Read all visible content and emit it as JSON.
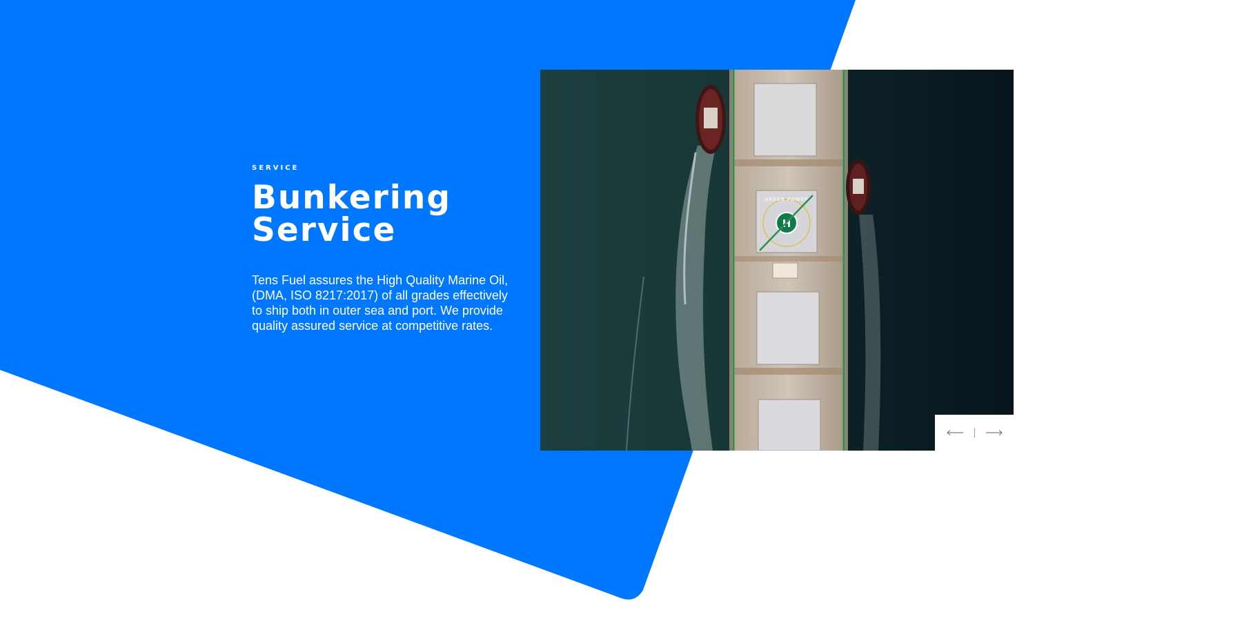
{
  "section": {
    "eyebrow": "SERVICE",
    "title": "Bunkering Service",
    "description": "Tens Fuel assures the High Quality Marine Oil, (DMA, ISO 8217:2017) of all grades effectively to ship both in outer sea and port. We provide quality assured service at competitive rates."
  },
  "slider": {
    "image_alt": "Aerial view of a tanker ship escorted by two tugboats",
    "deck_marking": "GREEN POWER",
    "helipad_letter": "H",
    "prev_icon": "arrow-left-icon",
    "next_icon": "arrow-right-icon"
  },
  "colors": {
    "accent_blue": "#0077FF",
    "background": "#FFFFFF",
    "text_on_accent": "#FFFFFF"
  }
}
